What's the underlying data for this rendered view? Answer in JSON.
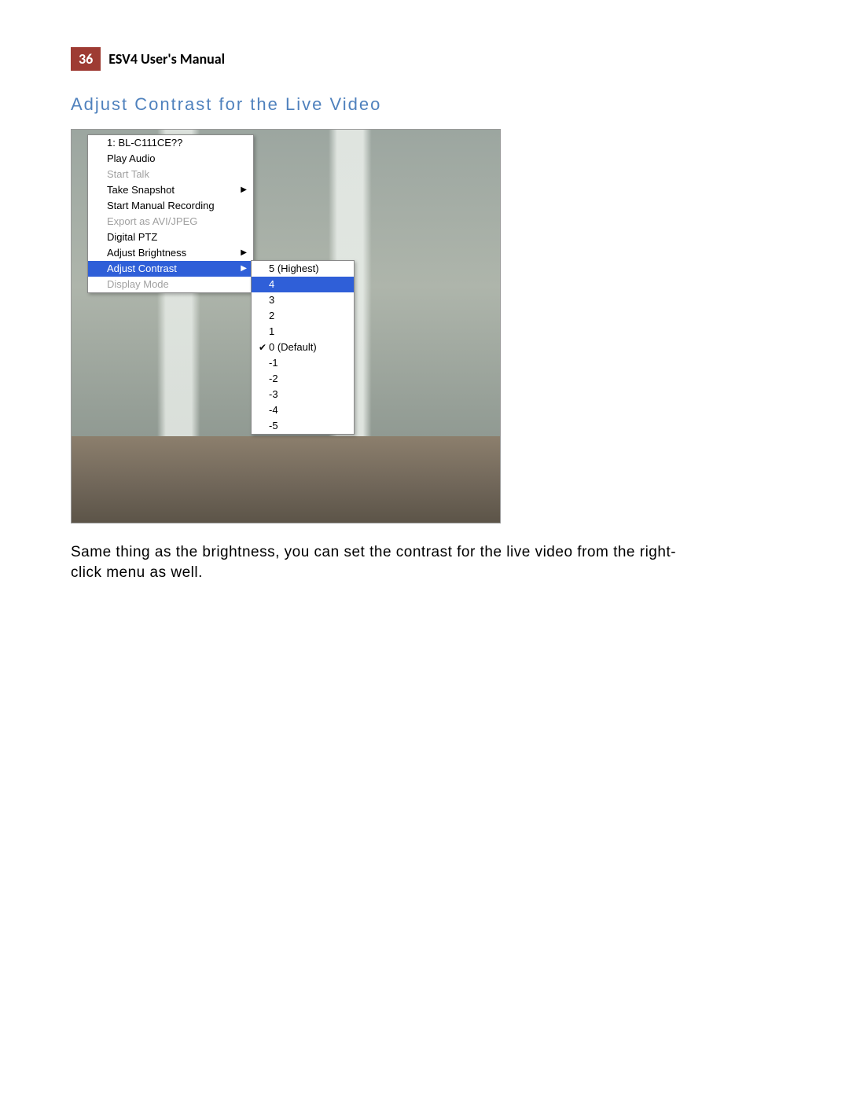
{
  "header": {
    "page_number": "36",
    "title": "ESV4 User's Manual"
  },
  "section_heading": "Adjust Contrast for the Live Video",
  "context_menu": {
    "items": [
      {
        "label": "1: BL-C111CE??",
        "disabled": false,
        "has_submenu": false,
        "highlighted": false
      },
      {
        "label": "Play Audio",
        "disabled": false,
        "has_submenu": false,
        "highlighted": false
      },
      {
        "label": "Start Talk",
        "disabled": true,
        "has_submenu": false,
        "highlighted": false
      },
      {
        "label": "Take Snapshot",
        "disabled": false,
        "has_submenu": true,
        "highlighted": false
      },
      {
        "label": "Start Manual Recording",
        "disabled": false,
        "has_submenu": false,
        "highlighted": false
      },
      {
        "label": "Export as AVI/JPEG",
        "disabled": true,
        "has_submenu": false,
        "highlighted": false
      },
      {
        "label": "Digital PTZ",
        "disabled": false,
        "has_submenu": false,
        "highlighted": false
      },
      {
        "label": "Adjust Brightness",
        "disabled": false,
        "has_submenu": true,
        "highlighted": false
      },
      {
        "label": "Adjust Contrast",
        "disabled": false,
        "has_submenu": true,
        "highlighted": true
      },
      {
        "label": "Display Mode",
        "disabled": true,
        "has_submenu": false,
        "highlighted": false
      }
    ]
  },
  "submenu": {
    "items": [
      {
        "label": "5 (Highest)",
        "checked": false,
        "highlighted": false
      },
      {
        "label": "4",
        "checked": false,
        "highlighted": true
      },
      {
        "label": "3",
        "checked": false,
        "highlighted": false
      },
      {
        "label": "2",
        "checked": false,
        "highlighted": false
      },
      {
        "label": "1",
        "checked": false,
        "highlighted": false
      },
      {
        "label": "0 (Default)",
        "checked": true,
        "highlighted": false
      },
      {
        "label": "-1",
        "checked": false,
        "highlighted": false
      },
      {
        "label": "-2",
        "checked": false,
        "highlighted": false
      },
      {
        "label": "-3",
        "checked": false,
        "highlighted": false
      },
      {
        "label": "-4",
        "checked": false,
        "highlighted": false
      },
      {
        "label": "-5",
        "checked": false,
        "highlighted": false
      }
    ]
  },
  "body_text": "Same thing as the brightness, you can set the contrast for the live video from the right-click menu as well."
}
